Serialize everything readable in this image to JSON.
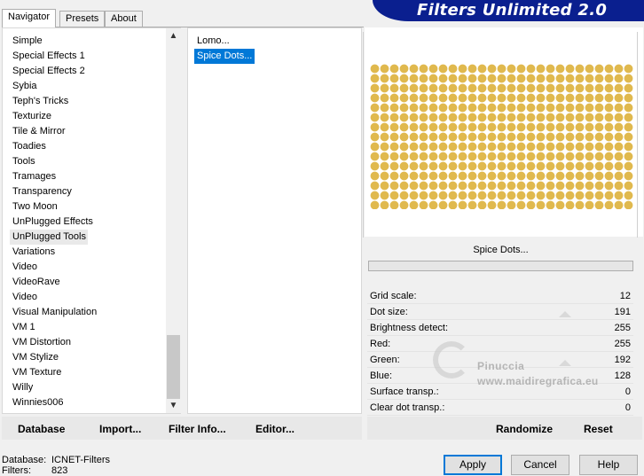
{
  "banner": {
    "title": "Filters Unlimited 2.0"
  },
  "tabs": [
    "Navigator",
    "Presets",
    "About"
  ],
  "categories": [
    "Simple",
    "Special Effects 1",
    "Special Effects 2",
    "Sybia",
    "Teph's Tricks",
    "Texturize",
    "Tile & Mirror",
    "Toadies",
    "Tools",
    "Tramages",
    "Transparency",
    "Two Moon",
    "UnPlugged Effects",
    "UnPlugged Tools",
    "Variations",
    "Video",
    "VideoRave",
    "Video",
    "Visual Manipulation",
    "VM 1",
    "VM Distortion",
    "VM Stylize",
    "VM Texture",
    "Willy",
    "Winnies006"
  ],
  "selected_category": "UnPlugged Tools",
  "filters": [
    "Lomo...",
    "Spice Dots..."
  ],
  "selected_filter": "Spice Dots...",
  "preview": {
    "filter_name": "Spice Dots...",
    "dot_color": "#e0b94e"
  },
  "params": [
    {
      "label": "Grid scale:",
      "value": "12"
    },
    {
      "label": "Dot size:",
      "value": "191"
    },
    {
      "label": "Brightness detect:",
      "value": "255"
    },
    {
      "label": "Red:",
      "value": "255"
    },
    {
      "label": "Green:",
      "value": "192"
    },
    {
      "label": "Blue:",
      "value": "128"
    },
    {
      "label": "Surface transp.:",
      "value": "0"
    },
    {
      "label": "Clear dot transp.:",
      "value": "0"
    }
  ],
  "toolbar": {
    "database": "Database",
    "import": "Import...",
    "filter_info": "Filter Info...",
    "editor": "Editor...",
    "randomize": "Randomize",
    "reset": "Reset"
  },
  "watermark": {
    "line1": "Pinuccia",
    "line2": "www.maidiregrafica.eu"
  },
  "status": {
    "database_label": "Database:",
    "database_value": "ICNET-Filters",
    "filters_label": "Filters:",
    "filters_value": "823"
  },
  "buttons": {
    "apply": "Apply",
    "cancel": "Cancel",
    "help": "Help"
  },
  "colors": {
    "banner": "#0a1f8f",
    "selection": "#0078d7",
    "dots": "#e0b94e"
  }
}
